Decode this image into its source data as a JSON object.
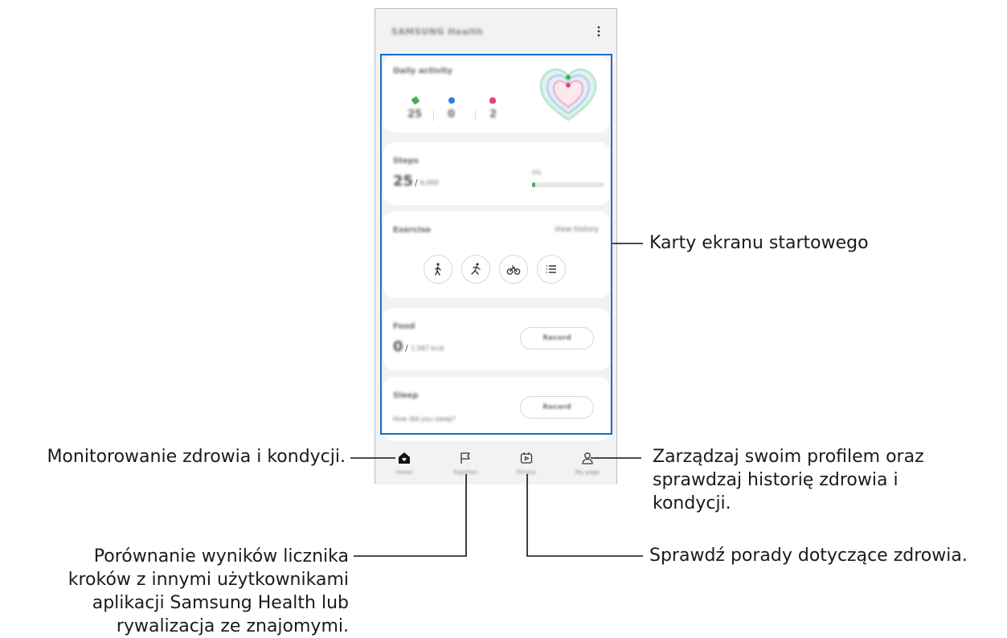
{
  "app": {
    "title": "SAMSUNG Health"
  },
  "cards": {
    "daily_activity": {
      "label": "Daily activity",
      "stats": [
        "25",
        "0",
        "2"
      ],
      "colors": {
        "steps": "#3fb05a",
        "active": "#2f7fd6",
        "calories": "#e0457b"
      }
    },
    "steps": {
      "label": "Steps",
      "value": "25",
      "separator": "/",
      "target": "6,000",
      "percent_label": "0%",
      "progress": 0.04
    },
    "exercise": {
      "label": "Exercise",
      "link": "View history",
      "buttons": [
        "walk-icon",
        "run-icon",
        "bike-icon",
        "list-icon"
      ]
    },
    "food": {
      "label": "Food",
      "value": "0",
      "separator": "/",
      "target": "1,587 kcal",
      "button": "Record"
    },
    "sleep": {
      "label": "Sleep",
      "prompt": "How did you sleep?",
      "button": "Record"
    }
  },
  "nav": {
    "items": [
      {
        "label": "Home",
        "icon": "home-icon"
      },
      {
        "label": "Together",
        "icon": "flag-icon"
      },
      {
        "label": "Fitness",
        "icon": "fitness-icon"
      },
      {
        "label": "My page",
        "icon": "person-icon"
      }
    ]
  },
  "callouts": {
    "home_cards": "Karty ekranu startowego",
    "monitoring": "Monitorowanie zdrowia i kondycji.",
    "profile": [
      "Zarządzaj swoim profilem oraz",
      "sprawdzaj historię zdrowia i",
      "kondycji."
    ],
    "together": [
      "Porównanie wyników licznika",
      "kroków z innymi użytkownikami",
      "aplikacji Samsung Health lub",
      "rywalizacja ze znajomymi."
    ],
    "fitness": "Sprawdź porady dotyczące zdrowia."
  },
  "colors": {
    "accent": "#1a6fc2",
    "background": "#f2f2f2"
  }
}
